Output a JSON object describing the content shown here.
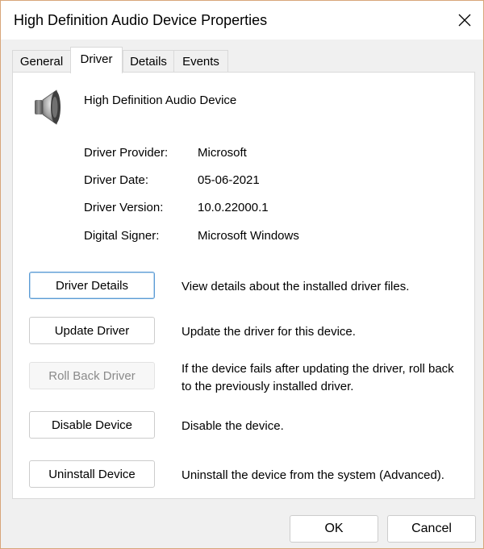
{
  "window": {
    "title": "High Definition Audio Device Properties"
  },
  "tabs": [
    {
      "label": "General",
      "active": false
    },
    {
      "label": "Driver",
      "active": true
    },
    {
      "label": "Details",
      "active": false
    },
    {
      "label": "Events",
      "active": false
    }
  ],
  "device": {
    "name": "High Definition Audio Device",
    "icon": "speaker-icon"
  },
  "driver_info": [
    {
      "label": "Driver Provider:",
      "value": "Microsoft"
    },
    {
      "label": "Driver Date:",
      "value": "05-06-2021"
    },
    {
      "label": "Driver Version:",
      "value": "10.0.22000.1"
    },
    {
      "label": "Digital Signer:",
      "value": "Microsoft Windows"
    }
  ],
  "actions": [
    {
      "label": "Driver Details",
      "description": "View details about the installed driver files.",
      "enabled": true
    },
    {
      "label": "Update Driver",
      "description": "Update the driver for this device.",
      "enabled": true
    },
    {
      "label": "Roll Back Driver",
      "description": "If the device fails after updating the driver, roll back to the previously installed driver.",
      "enabled": false
    },
    {
      "label": "Disable Device",
      "description": "Disable the device.",
      "enabled": true
    },
    {
      "label": "Uninstall Device",
      "description": "Uninstall the device from the system (Advanced).",
      "enabled": true
    }
  ],
  "footer": {
    "ok_label": "OK",
    "cancel_label": "Cancel"
  },
  "colors": {
    "window_border": "#d8a67a",
    "focus_border": "#5b9bd5"
  }
}
